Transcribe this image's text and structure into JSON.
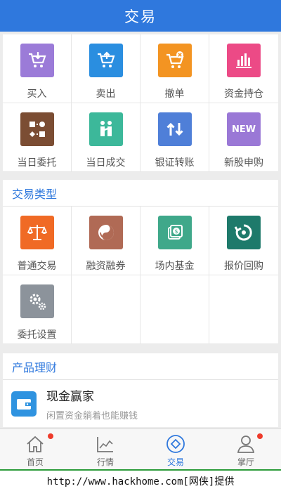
{
  "header": {
    "title": "交易"
  },
  "trade_grid": [
    {
      "label": "买入",
      "icon": "cart-download-icon",
      "color": "#9b7bd8"
    },
    {
      "label": "卖出",
      "icon": "cart-upload-icon",
      "color": "#2a8ee0"
    },
    {
      "label": "撤单",
      "icon": "cart-cancel-icon",
      "color": "#f39422"
    },
    {
      "label": "资金持仓",
      "icon": "bar-chart-icon",
      "color": "#ec4a86"
    },
    {
      "label": "当日委托",
      "icon": "exchange-grid-icon",
      "color": "#7b4d33"
    },
    {
      "label": "当日成交",
      "icon": "handshake-icon",
      "color": "#3cb89a"
    },
    {
      "label": "银证转账",
      "icon": "transfer-arrows-icon",
      "color": "#4f7fd8"
    },
    {
      "label": "新股申购",
      "icon": "new-badge-icon",
      "color": "#9a78d6",
      "badge_text": "NEW"
    }
  ],
  "types_section": {
    "title": "交易类型"
  },
  "type_grid": [
    {
      "label": "普通交易",
      "icon": "scale-icon",
      "color": "#f06a25"
    },
    {
      "label": "融资融券",
      "icon": "yin-yang-icon",
      "color": "#b06a55"
    },
    {
      "label": "场内基金",
      "icon": "fund-coin-icon",
      "color": "#3fa88a"
    },
    {
      "label": "报价回购",
      "icon": "refresh-icon",
      "color": "#1e7a6b"
    },
    {
      "label": "委托设置",
      "icon": "gears-icon",
      "color": "#8c939b"
    }
  ],
  "products_section": {
    "title": "产品理财"
  },
  "product": {
    "name": "现金赢家",
    "desc": "闲置资金躺着也能赚钱",
    "icon": "wallet-icon"
  },
  "tabbar": [
    {
      "label": "首页",
      "icon": "home-icon",
      "dot": true,
      "active": false
    },
    {
      "label": "行情",
      "icon": "chart-line-icon",
      "dot": false,
      "active": false
    },
    {
      "label": "交易",
      "icon": "trade-diamond-icon",
      "dot": false,
      "active": true
    },
    {
      "label": "掌厅",
      "icon": "user-icon",
      "dot": true,
      "active": false
    }
  ],
  "footer": {
    "url_text": "http://www.hackhome.com[网侠]提供"
  }
}
